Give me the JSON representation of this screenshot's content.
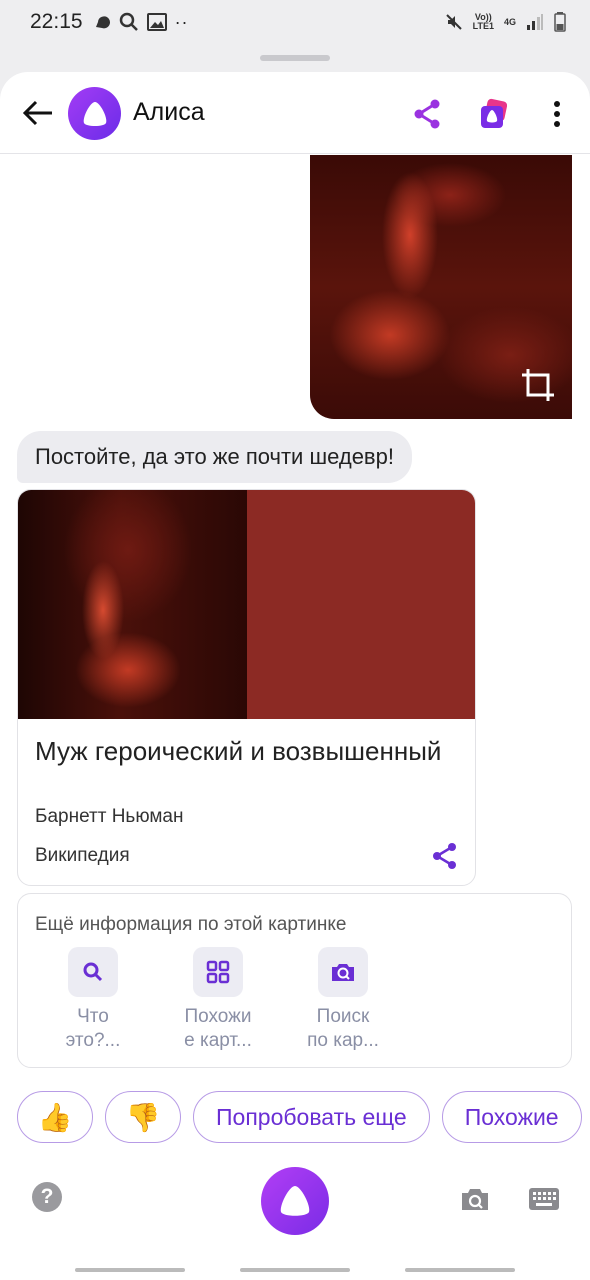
{
  "status_bar": {
    "time": "22:15",
    "network_top": "Vo))",
    "network_bottom": "LTE1",
    "net_type": "4G"
  },
  "header": {
    "title": "Алиса"
  },
  "chat": {
    "assistant_message": "Постойте, да это же почти шедевр!",
    "card": {
      "title": "Муж героический и возвышенный",
      "author": "Барнетт Ньюман",
      "source": "Википедия"
    },
    "more_info": {
      "title": "Ещё информация по этой картинке",
      "items": [
        {
          "label_line1": "Что",
          "label_line2": "это?...",
          "icon": "search-icon"
        },
        {
          "label_line1": "Похожи",
          "label_line2": "е карт...",
          "icon": "grid-icon"
        },
        {
          "label_line1": "Поиск",
          "label_line2": "по кар...",
          "icon": "camera-search-icon"
        }
      ]
    }
  },
  "suggestions": {
    "thumbs_up": "👍",
    "thumbs_down": "👎",
    "try_again": "Попробовать еще",
    "similar": "Похожие"
  },
  "bottom_bar": {
    "help_label": "?"
  },
  "colors": {
    "accent": "#6a2fd4",
    "alice_gradient_start": "#a33cf5",
    "alice_gradient_end": "#6b2ce8",
    "share_icon": "#9a32e0"
  }
}
